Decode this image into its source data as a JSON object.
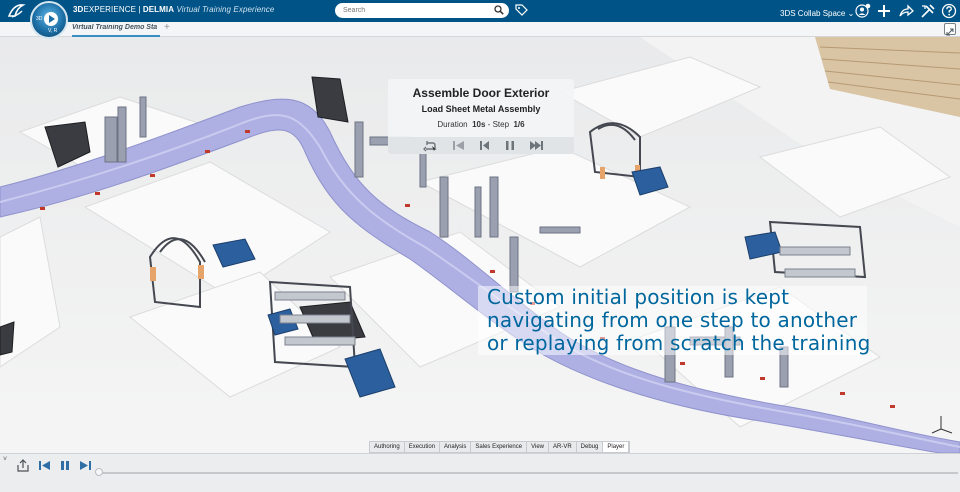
{
  "topbar": {
    "brand_bold": "3D",
    "brand_rest": "EXPERIENCE | ",
    "brand_app": "DELMIA",
    "brand_italic": "Virtual Training Experience",
    "compass_3d": "3D",
    "compass_v": "V, R",
    "search_placeholder": "Search",
    "collab_space": "3DS Collab Space",
    "icons": [
      "ds-logo-icon",
      "compass-icon",
      "search-icon",
      "tag-icon",
      "user-icon",
      "plus-icon",
      "share-icon",
      "tools-icon",
      "help-icon"
    ]
  },
  "tabs": {
    "active": "Virtual Training Demo Sta",
    "add": "+"
  },
  "steppanel": {
    "title": "Assemble Door Exterior",
    "subtitle": "Load Sheet Metal Assembly",
    "duration_label": "Duration",
    "duration_value": "10s",
    "sep": " - ",
    "step_label": "Step",
    "step_value": "1/6"
  },
  "caption": {
    "line1": "Custom initial position is kept",
    "line2": "navigating from one step to another",
    "line3": "or replaying from scratch the training"
  },
  "workbench_tabs": [
    {
      "label": "Authoring"
    },
    {
      "label": "Execution"
    },
    {
      "label": "Analysis"
    },
    {
      "label": "Sales Experience"
    },
    {
      "label": "View"
    },
    {
      "label": "AR-VR"
    },
    {
      "label": "Debug"
    },
    {
      "label": "Player"
    }
  ],
  "active_workbench": "Player",
  "playbar": {
    "chevron": "˅",
    "progress": 0
  },
  "colors": {
    "topbar": "#005386",
    "accent": "#00679e",
    "conveyor": "#aeb0e4"
  }
}
